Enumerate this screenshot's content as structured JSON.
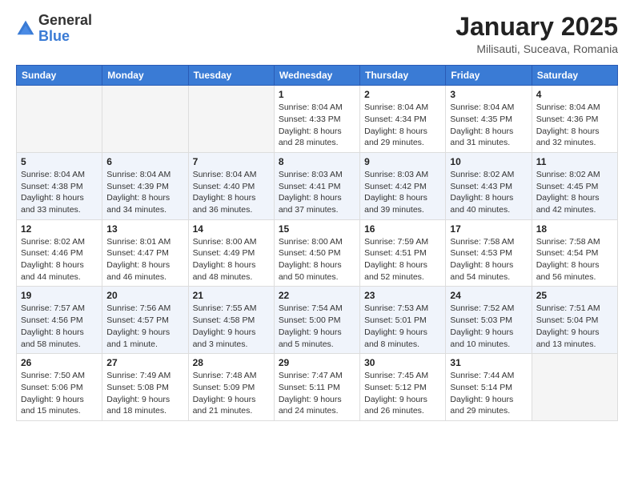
{
  "logo": {
    "text_general": "General",
    "text_blue": "Blue"
  },
  "title": "January 2025",
  "subtitle": "Milisauti, Suceava, Romania",
  "days_of_week": [
    "Sunday",
    "Monday",
    "Tuesday",
    "Wednesday",
    "Thursday",
    "Friday",
    "Saturday"
  ],
  "weeks": [
    [
      {
        "day": "",
        "info": ""
      },
      {
        "day": "",
        "info": ""
      },
      {
        "day": "",
        "info": ""
      },
      {
        "day": "1",
        "info": "Sunrise: 8:04 AM\nSunset: 4:33 PM\nDaylight: 8 hours\nand 28 minutes."
      },
      {
        "day": "2",
        "info": "Sunrise: 8:04 AM\nSunset: 4:34 PM\nDaylight: 8 hours\nand 29 minutes."
      },
      {
        "day": "3",
        "info": "Sunrise: 8:04 AM\nSunset: 4:35 PM\nDaylight: 8 hours\nand 31 minutes."
      },
      {
        "day": "4",
        "info": "Sunrise: 8:04 AM\nSunset: 4:36 PM\nDaylight: 8 hours\nand 32 minutes."
      }
    ],
    [
      {
        "day": "5",
        "info": "Sunrise: 8:04 AM\nSunset: 4:38 PM\nDaylight: 8 hours\nand 33 minutes."
      },
      {
        "day": "6",
        "info": "Sunrise: 8:04 AM\nSunset: 4:39 PM\nDaylight: 8 hours\nand 34 minutes."
      },
      {
        "day": "7",
        "info": "Sunrise: 8:04 AM\nSunset: 4:40 PM\nDaylight: 8 hours\nand 36 minutes."
      },
      {
        "day": "8",
        "info": "Sunrise: 8:03 AM\nSunset: 4:41 PM\nDaylight: 8 hours\nand 37 minutes."
      },
      {
        "day": "9",
        "info": "Sunrise: 8:03 AM\nSunset: 4:42 PM\nDaylight: 8 hours\nand 39 minutes."
      },
      {
        "day": "10",
        "info": "Sunrise: 8:02 AM\nSunset: 4:43 PM\nDaylight: 8 hours\nand 40 minutes."
      },
      {
        "day": "11",
        "info": "Sunrise: 8:02 AM\nSunset: 4:45 PM\nDaylight: 8 hours\nand 42 minutes."
      }
    ],
    [
      {
        "day": "12",
        "info": "Sunrise: 8:02 AM\nSunset: 4:46 PM\nDaylight: 8 hours\nand 44 minutes."
      },
      {
        "day": "13",
        "info": "Sunrise: 8:01 AM\nSunset: 4:47 PM\nDaylight: 8 hours\nand 46 minutes."
      },
      {
        "day": "14",
        "info": "Sunrise: 8:00 AM\nSunset: 4:49 PM\nDaylight: 8 hours\nand 48 minutes."
      },
      {
        "day": "15",
        "info": "Sunrise: 8:00 AM\nSunset: 4:50 PM\nDaylight: 8 hours\nand 50 minutes."
      },
      {
        "day": "16",
        "info": "Sunrise: 7:59 AM\nSunset: 4:51 PM\nDaylight: 8 hours\nand 52 minutes."
      },
      {
        "day": "17",
        "info": "Sunrise: 7:58 AM\nSunset: 4:53 PM\nDaylight: 8 hours\nand 54 minutes."
      },
      {
        "day": "18",
        "info": "Sunrise: 7:58 AM\nSunset: 4:54 PM\nDaylight: 8 hours\nand 56 minutes."
      }
    ],
    [
      {
        "day": "19",
        "info": "Sunrise: 7:57 AM\nSunset: 4:56 PM\nDaylight: 8 hours\nand 58 minutes."
      },
      {
        "day": "20",
        "info": "Sunrise: 7:56 AM\nSunset: 4:57 PM\nDaylight: 9 hours\nand 1 minute."
      },
      {
        "day": "21",
        "info": "Sunrise: 7:55 AM\nSunset: 4:58 PM\nDaylight: 9 hours\nand 3 minutes."
      },
      {
        "day": "22",
        "info": "Sunrise: 7:54 AM\nSunset: 5:00 PM\nDaylight: 9 hours\nand 5 minutes."
      },
      {
        "day": "23",
        "info": "Sunrise: 7:53 AM\nSunset: 5:01 PM\nDaylight: 9 hours\nand 8 minutes."
      },
      {
        "day": "24",
        "info": "Sunrise: 7:52 AM\nSunset: 5:03 PM\nDaylight: 9 hours\nand 10 minutes."
      },
      {
        "day": "25",
        "info": "Sunrise: 7:51 AM\nSunset: 5:04 PM\nDaylight: 9 hours\nand 13 minutes."
      }
    ],
    [
      {
        "day": "26",
        "info": "Sunrise: 7:50 AM\nSunset: 5:06 PM\nDaylight: 9 hours\nand 15 minutes."
      },
      {
        "day": "27",
        "info": "Sunrise: 7:49 AM\nSunset: 5:08 PM\nDaylight: 9 hours\nand 18 minutes."
      },
      {
        "day": "28",
        "info": "Sunrise: 7:48 AM\nSunset: 5:09 PM\nDaylight: 9 hours\nand 21 minutes."
      },
      {
        "day": "29",
        "info": "Sunrise: 7:47 AM\nSunset: 5:11 PM\nDaylight: 9 hours\nand 24 minutes."
      },
      {
        "day": "30",
        "info": "Sunrise: 7:45 AM\nSunset: 5:12 PM\nDaylight: 9 hours\nand 26 minutes."
      },
      {
        "day": "31",
        "info": "Sunrise: 7:44 AM\nSunset: 5:14 PM\nDaylight: 9 hours\nand 29 minutes."
      },
      {
        "day": "",
        "info": ""
      }
    ]
  ]
}
